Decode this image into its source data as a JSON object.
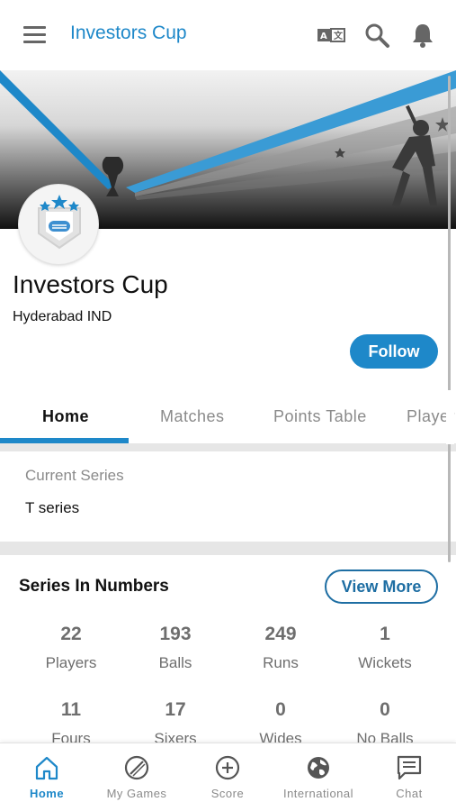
{
  "appbar": {
    "title": "Investors Cup",
    "icons": [
      "menu-icon",
      "translate-icon",
      "search-icon",
      "bell-icon"
    ]
  },
  "profile": {
    "name": "Investors Cup",
    "location": "Hyderabad IND",
    "follow_label": "Follow"
  },
  "tabs": [
    {
      "label": "Home",
      "active": true
    },
    {
      "label": "Matches",
      "active": false
    },
    {
      "label": "Points Table",
      "active": false
    },
    {
      "label": "Player",
      "active": false
    }
  ],
  "current_series": {
    "label": "Current Series",
    "value": "T series"
  },
  "series_numbers": {
    "title": "Series In Numbers",
    "view_more_label": "View More",
    "stats": [
      {
        "value": "22",
        "label": "Players"
      },
      {
        "value": "193",
        "label": "Balls"
      },
      {
        "value": "249",
        "label": "Runs"
      },
      {
        "value": "1",
        "label": "Wickets"
      },
      {
        "value": "11",
        "label": "Fours"
      },
      {
        "value": "17",
        "label": "Sixers"
      },
      {
        "value": "0",
        "label": "Wides"
      },
      {
        "value": "0",
        "label": "No Balls"
      }
    ]
  },
  "bottom_nav": [
    {
      "label": "Home",
      "icon": "home-icon",
      "active": true
    },
    {
      "label": "My Games",
      "icon": "bat-ball-icon",
      "active": false
    },
    {
      "label": "Score",
      "icon": "plus-circle-icon",
      "active": false
    },
    {
      "label": "International",
      "icon": "globe-icon",
      "active": false
    },
    {
      "label": "Chat",
      "icon": "chat-icon",
      "active": false
    }
  ],
  "colors": {
    "accent": "#1e88c9",
    "text_muted": "#8a8a8a",
    "divider": "#e6e6e6"
  }
}
